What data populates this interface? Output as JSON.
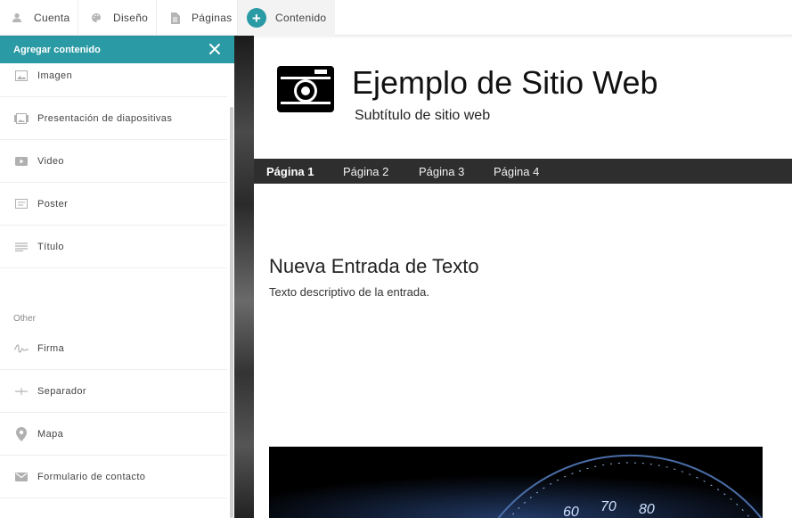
{
  "toolbar": {
    "items": [
      {
        "label": "Cuenta",
        "icon": "user-icon"
      },
      {
        "label": "Diseño",
        "icon": "palette-icon"
      },
      {
        "label": "Páginas",
        "icon": "page-icon"
      },
      {
        "label": "Contenido",
        "icon": "plus-circle-icon"
      }
    ]
  },
  "panel": {
    "title": "Agregar contenido",
    "items": [
      {
        "label": "Imagen",
        "icon": "image-icon"
      },
      {
        "label": "Presentación de diapositivas",
        "icon": "slideshow-icon"
      },
      {
        "label": "Video",
        "icon": "video-icon"
      },
      {
        "label": "Poster",
        "icon": "poster-icon"
      },
      {
        "label": "Título",
        "icon": "title-icon"
      }
    ],
    "section_other": "Other",
    "other_items": [
      {
        "label": "Firma",
        "icon": "signature-icon"
      },
      {
        "label": "Separador",
        "icon": "separator-icon"
      },
      {
        "label": "Mapa",
        "icon": "map-pin-icon"
      },
      {
        "label": "Formulario de contacto",
        "icon": "mail-icon"
      }
    ]
  },
  "site": {
    "title": "Ejemplo de Sitio Web",
    "subtitle": "Subtítulo de sitio web",
    "nav": [
      "Página 1",
      "Página 2",
      "Página 3",
      "Página 4"
    ],
    "active_nav": "Página 1",
    "post_title": "Nueva Entrada de Texto",
    "post_text": "Texto descriptivo de la entrada.",
    "speedometer_labels": [
      "60",
      "70",
      "80"
    ]
  },
  "colors": {
    "accent": "#2a9aa5",
    "nav_bg": "#2e2e2e"
  }
}
